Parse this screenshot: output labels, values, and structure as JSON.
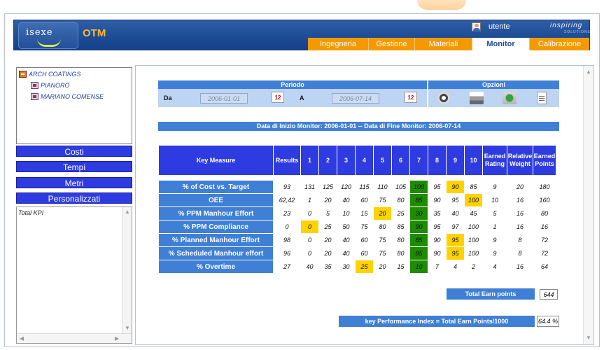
{
  "header": {
    "logo": "isexe",
    "app_name": "OTM",
    "user": "utente",
    "brand": "inspiring",
    "brand_sub": "SOLUTIONS",
    "nav": [
      "Ingegneria",
      "Gestione",
      "Materiali",
      "Monitor",
      "Calibrazione"
    ],
    "active_nav": "Monitor"
  },
  "tree": {
    "root": "ARCH COATINGS",
    "children": [
      "PIANORO",
      "MARIANO COMENSE"
    ]
  },
  "menu": [
    "Costi",
    "Tempi",
    "Metri",
    "Personalizzati"
  ],
  "kpi_list": [
    "Total KPI"
  ],
  "filters": {
    "periodo_label": "Periodo",
    "opzioni_label": "Opzioni",
    "da_label": "Da",
    "a_label": "A",
    "date_from": "2006-01-01",
    "date_to": "2006-07-14",
    "calendar_text": "12"
  },
  "info_bar": "Data di Inizio Monitor: 2006-01-01 -- Data di Fine Monitor: 2006-07-14",
  "table": {
    "headers": [
      "Key Measure",
      "Results",
      "1",
      "2",
      "3",
      "4",
      "5",
      "6",
      "7",
      "8",
      "9",
      "10",
      "Earned Rating",
      "Relative Weight",
      "Earned Points"
    ],
    "rows": [
      {
        "label": "% of Cost vs. Target",
        "results": "93",
        "scores": [
          "131",
          "125",
          "120",
          "115",
          "110",
          "105",
          "100",
          "95",
          "90",
          "85"
        ],
        "earned_rating": "9",
        "relative_weight": "20",
        "earned_points": "180"
      },
      {
        "label": "OEE",
        "results": "62,42",
        "scores": [
          "1",
          "20",
          "40",
          "60",
          "75",
          "80",
          "85",
          "90",
          "95",
          "100"
        ],
        "earned_rating": "10",
        "relative_weight": "16",
        "earned_points": "160"
      },
      {
        "label": "% PPM Manhour Effort",
        "results": "23",
        "scores": [
          "0",
          "5",
          "10",
          "15",
          "20",
          "25",
          "30",
          "35",
          "40",
          "45"
        ],
        "earned_rating": "5",
        "relative_weight": "16",
        "earned_points": "80"
      },
      {
        "label": "% PPM Compliance",
        "results": "0",
        "scores": [
          "0",
          "25",
          "50",
          "75",
          "80",
          "85",
          "90",
          "95",
          "97",
          "100"
        ],
        "earned_rating": "1",
        "relative_weight": "16",
        "earned_points": "16"
      },
      {
        "label": "% Planned Manhour Effort",
        "results": "98",
        "scores": [
          "0",
          "20",
          "40",
          "60",
          "75",
          "80",
          "85",
          "90",
          "95",
          "100"
        ],
        "earned_rating": "9",
        "relative_weight": "8",
        "earned_points": "72"
      },
      {
        "label": "% Scheduled Manhour effort",
        "results": "96",
        "scores": [
          "0",
          "20",
          "40",
          "60",
          "75",
          "80",
          "85",
          "90",
          "95",
          "100"
        ],
        "earned_rating": "9",
        "relative_weight": "8",
        "earned_points": "72"
      },
      {
        "label": "% Overtime",
        "results": "27",
        "scores": [
          "40",
          "35",
          "30",
          "25",
          "20",
          "15",
          "10",
          "7",
          "4",
          "2"
        ],
        "earned_rating": "4",
        "relative_weight": "16",
        "earned_points": "64"
      }
    ],
    "highlights": {
      "yellow_color": "#ffd200",
      "green_color": "#1e8c00",
      "cells": [
        [
          0,
          8,
          "yellow"
        ],
        [
          1,
          9,
          "yellow"
        ],
        [
          2,
          4,
          "yellow"
        ],
        [
          3,
          0,
          "yellow"
        ],
        [
          4,
          8,
          "yellow"
        ],
        [
          5,
          8,
          "yellow"
        ],
        [
          6,
          3,
          "yellow"
        ]
      ],
      "green_column": 6
    }
  },
  "total_earn_label": "Total Earn points",
  "total_earn_value": "644",
  "kpi_index_label": "key Performance Index = Total Earn Points/1000",
  "kpi_index_value": "64.4 %",
  "colors": {
    "header_blue": "#1e4c95",
    "nav_orange": "#f39a00",
    "menu_blue": "#2e3be0",
    "light_blue": "#3f7fd6"
  }
}
